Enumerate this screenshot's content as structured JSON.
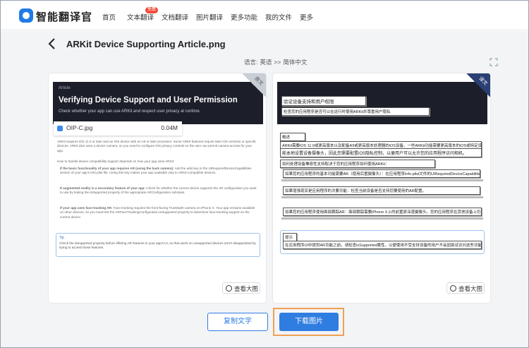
{
  "app": {
    "brand": "智能翻译官"
  },
  "nav": {
    "items": [
      "首页",
      "文本翻译",
      "文档翻译",
      "图片翻译",
      "更多功能",
      "我的文件",
      "更多"
    ],
    "hot_badge": "免费"
  },
  "header": {
    "title": "ARKit Device Supporting Article.png"
  },
  "lang": {
    "label": "语言:",
    "source": "英语",
    "arrow": ">>",
    "target": "简体中文"
  },
  "left_card": {
    "corner_label": "原文",
    "eyebrow": "Article",
    "title": "Verifying Device Support and User Permission",
    "subtitle": "Check whether your app can use ARKit and respect user privacy at runtime.",
    "file_name": "OIP-C.jpg",
    "file_size": "0.04M",
    "section_heading": "Overview",
    "para1": "ARKit requires iOS 11.0 or later and an iOS device with an A9 or later processor. Some ARKit features require later iOS versions or specific devices. ARKit also uses a device camera, so you need to configure iOS privacy controls so the user can permit camera access for your app.",
    "para2": "How to handle device compatibility support depends on how your app uses ARKit:",
    "bullet1_bold": "If the basic functionality of your app requires AR (using the back camera):",
    "bullet1": "Add the arkit key in the UIRequiredDeviceCapabilities section of your app's Info.plist file. Using this key makes your app available only to ARKit-compatible devices.",
    "bullet2_bold": "If augmented reality is a secondary feature of your app:",
    "bullet2": "Check for whether the current device supports the AR configuration you want to use by testing the isSupported property of the appropriate ARConfiguration subclass.",
    "bullet3_bold": "If your app uses face-tracking AR:",
    "bullet3": "Face tracking requires the front-facing TrueDepth camera on iPhone X. Your app remains available on other devices, so you must test the ARFaceTrackingConfiguration.isSupported property to determine face-tracking support on the current device.",
    "tip_title": "Tip",
    "tip_text": "Check the isSupported property before offering AR features in your app's UI, so that users on unsupported devices aren't disappointed by trying to access those features.",
    "zoom_label": "查看大图"
  },
  "right_card": {
    "corner_label": "译文",
    "title": "验证设备支持和用户权限",
    "subtitle": "检查您的应用程序是否可以在运行时使用ARKit并尊重用户隐私",
    "section_heading": "概述",
    "para1": "ARKit需要iOS 11.0或更高版本以及配备A9或更高版本处理器的iOS设备。一些ARKit功能需要更高版本的iOS或特定设备。",
    "para2": "能本地设置设备摄像头，因此您需要配置iOS隐私控制，以便用户可以允许您的应用程序访问相机。",
    "para3": "如何处理设备兼容性支持取决于您的应用程序如何使用ARKit：",
    "bullet1": "如果您的应用程序的基本功能需要AR（使用后置摄像头）：在应用程序Info.plist文件的UIRequiredDeviceCapabilities部分添加arkit键。",
    "bullet2": "如果增强现实是应用程序的次要功能：检查当前设备是否支持您要使用的AR配置。",
    "bullet3": "如果您的应用程序使用面部跟踪AR：面部跟踪需要iPhone X上的前置原深感摄像头。您的应用程序在其他设备上仍然可用，因此必须测试ARFaceTrackingConfiguration.isSupported属性。",
    "tip_title": "提示",
    "tip_text": "在应用程序UI中提供AR功能之前，请检查isSupported属性，以便使用不受支持设备的用户不会因尝试访问这些功能而失望。",
    "zoom_label": "查看大图"
  },
  "actions": {
    "copy_label": "复制文字",
    "download_label": "下载图片"
  },
  "colors": {
    "accent": "#2f7de1",
    "highlight": "#f0a055",
    "dark_header": "#1c1f2a"
  }
}
